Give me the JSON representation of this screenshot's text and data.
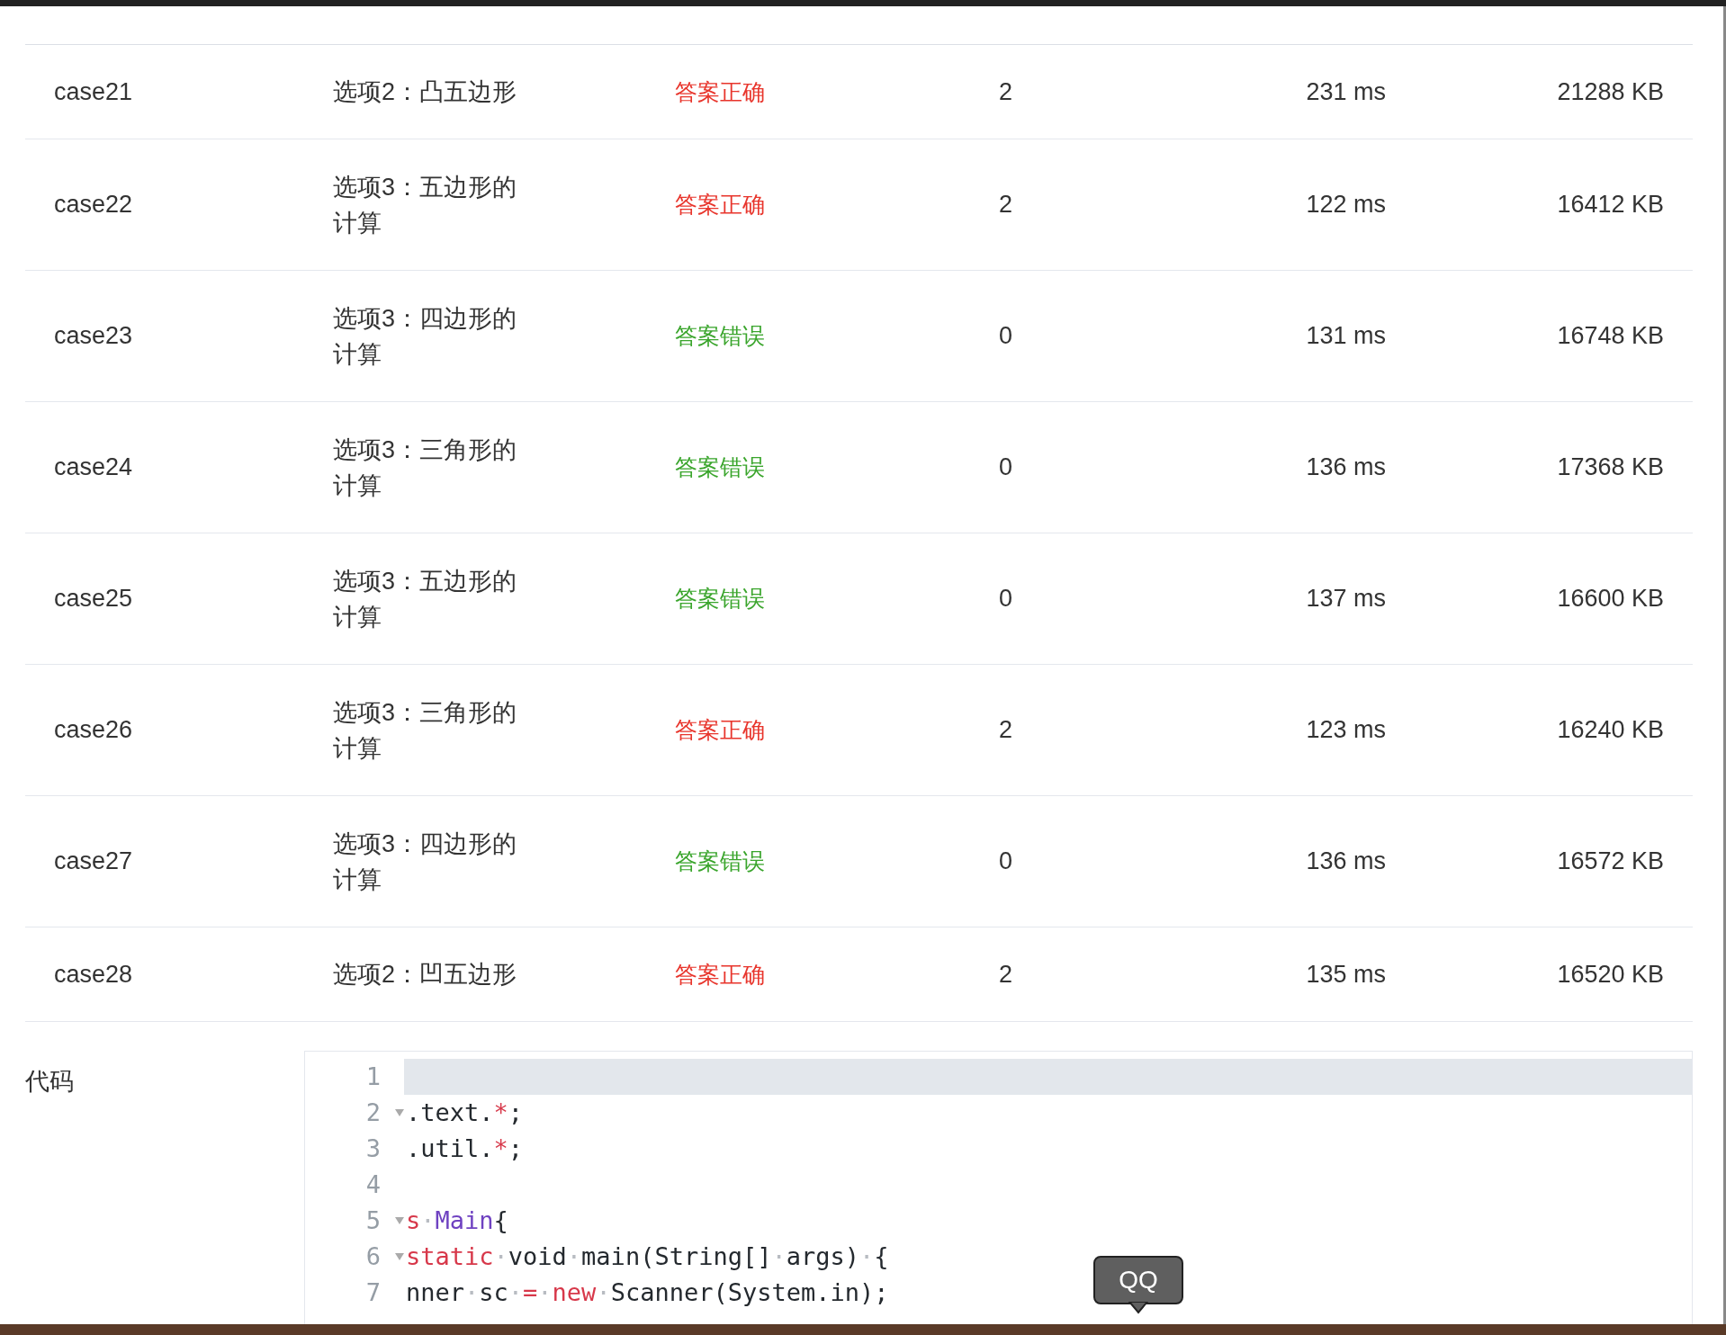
{
  "table": {
    "rows": [
      {
        "case": "case21",
        "option": "选项2：凸五边形",
        "result": "答案正确",
        "color": "#e8352c",
        "score": "2",
        "time": "231 ms",
        "memory": "21288 KB"
      },
      {
        "case": "case22",
        "option": "选项3：五边形的计算",
        "result": "答案正确",
        "color": "#e8352c",
        "score": "2",
        "time": "122 ms",
        "memory": "16412 KB"
      },
      {
        "case": "case23",
        "option": "选项3：四边形的计算",
        "result": "答案错误",
        "color": "#3aa52c",
        "score": "0",
        "time": "131 ms",
        "memory": "16748 KB"
      },
      {
        "case": "case24",
        "option": "选项3：三角形的计算",
        "result": "答案错误",
        "color": "#3aa52c",
        "score": "0",
        "time": "136 ms",
        "memory": "17368 KB"
      },
      {
        "case": "case25",
        "option": "选项3：五边形的计算",
        "result": "答案错误",
        "color": "#3aa52c",
        "score": "0",
        "time": "137 ms",
        "memory": "16600 KB"
      },
      {
        "case": "case26",
        "option": "选项3：三角形的计算",
        "result": "答案正确",
        "color": "#e8352c",
        "score": "2",
        "time": "123 ms",
        "memory": "16240 KB"
      },
      {
        "case": "case27",
        "option": "选项3：四边形的计算",
        "result": "答案错误",
        "color": "#3aa52c",
        "score": "0",
        "time": "136 ms",
        "memory": "16572 KB"
      },
      {
        "case": "case28",
        "option": "选项2：凹五边形",
        "result": "答案正确",
        "color": "#e8352c",
        "score": "2",
        "time": "135 ms",
        "memory": "16520 KB"
      }
    ]
  },
  "code": {
    "label": "代码",
    "lines": [
      {
        "number": "1",
        "fold": false,
        "active": true
      },
      {
        "number": "2",
        "fold": true,
        "active": false,
        "tokens": [
          {
            "text": ".text.",
            "kind": "plain"
          },
          {
            "text": "*",
            "kind": "keyword"
          },
          {
            "text": ";",
            "kind": "plain"
          }
        ]
      },
      {
        "number": "3",
        "fold": false,
        "active": false,
        "tokens": [
          {
            "text": ".util.",
            "kind": "plain"
          },
          {
            "text": "*",
            "kind": "keyword"
          },
          {
            "text": ";",
            "kind": "plain"
          }
        ]
      },
      {
        "number": "4",
        "fold": false,
        "active": false
      },
      {
        "number": "5",
        "fold": true,
        "active": false,
        "tokens": [
          {
            "text": "s",
            "kind": "keyword"
          },
          {
            "text": "·",
            "kind": "space"
          },
          {
            "text": "Main",
            "kind": "type"
          },
          {
            "text": "{",
            "kind": "plain"
          }
        ]
      },
      {
        "number": "6",
        "fold": true,
        "active": false,
        "tokens": [
          {
            "text": "static",
            "kind": "keyword"
          },
          {
            "text": "·",
            "kind": "space"
          },
          {
            "text": "void",
            "kind": "plain"
          },
          {
            "text": "·",
            "kind": "space"
          },
          {
            "text": "main(String[]",
            "kind": "plain"
          },
          {
            "text": "·",
            "kind": "space"
          },
          {
            "text": "args)",
            "kind": "plain"
          },
          {
            "text": "·",
            "kind": "space"
          },
          {
            "text": "{",
            "kind": "plain"
          }
        ]
      },
      {
        "number": "7",
        "fold": false,
        "active": false,
        "tokens": [
          {
            "text": "nner",
            "kind": "plain"
          },
          {
            "text": "·",
            "kind": "space"
          },
          {
            "text": "sc",
            "kind": "plain"
          },
          {
            "text": "·",
            "kind": "space"
          },
          {
            "text": "=",
            "kind": "keyword"
          },
          {
            "text": "·",
            "kind": "space"
          },
          {
            "text": "new",
            "kind": "keyword"
          },
          {
            "text": "·",
            "kind": "space"
          },
          {
            "text": "Scanner(System.in);",
            "kind": "plain"
          }
        ]
      }
    ]
  },
  "tooltip": {
    "text": "QQ"
  }
}
